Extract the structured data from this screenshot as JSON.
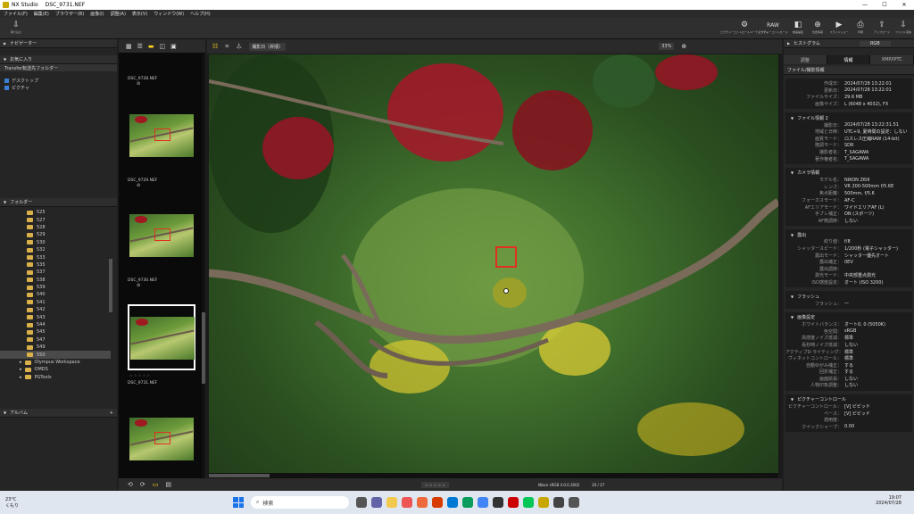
{
  "window": {
    "app": "NX Studio",
    "file": "DSC_9731.NEF",
    "min": "—",
    "max": "☐",
    "close": "✕"
  },
  "menu": [
    "ファイル(F)",
    "編集(E)",
    "ブラウザー(B)",
    "画像(I)",
    "調整(A)",
    "表示(V)",
    "ウィンドウ(W)",
    "ヘルプ(H)"
  ],
  "toolbar": {
    "import": "取り込む",
    "right": [
      {
        "icon": "picture-control-icon",
        "glyph": "⚙",
        "label": "ピクチャーコントロールユーティリティ"
      },
      {
        "icon": "raw-icon",
        "glyph": "RAW",
        "label": "ピクチャーコントロール"
      },
      {
        "icon": "compare-icon",
        "glyph": "◧",
        "label": "動画編集"
      },
      {
        "icon": "map-icon",
        "glyph": "⊕",
        "label": "位置情報"
      },
      {
        "icon": "slideshow-icon",
        "glyph": "▶",
        "label": "スライドショー"
      },
      {
        "icon": "print-icon",
        "glyph": "⎙",
        "label": "印刷"
      },
      {
        "icon": "upload-icon",
        "glyph": "⇪",
        "label": "アップロード"
      },
      {
        "icon": "export-icon",
        "glyph": "⇩",
        "label": "ファイル変換"
      }
    ]
  },
  "left": {
    "navigator": "ナビゲーター",
    "favorites": "お気に入り",
    "fav_items": [
      "Transfer転送先フォルダー",
      "デスクトップ",
      "ピクチャ"
    ],
    "folders_title": "フォルダー",
    "folders": [
      "525",
      "527",
      "528",
      "529",
      "530",
      "532",
      "533",
      "535",
      "537",
      "538",
      "539",
      "540",
      "541",
      "542",
      "543",
      "544",
      "545",
      "547",
      "549",
      "550"
    ],
    "subfolders": [
      "Olympus Workspace",
      "OMDS",
      "PGTools"
    ],
    "albums": "アルバム"
  },
  "filmstrip": {
    "items": [
      {
        "name": "DSC_9728.NEF"
      },
      {
        "name": "DSC_9729.NEF"
      },
      {
        "name": "DSC_9730.NEF"
      },
      {
        "name": "DSC_9731.NEF"
      }
    ],
    "rating": "☆ ☆ ☆ ☆ ☆"
  },
  "viewer": {
    "sort": "撮影日（昇順）",
    "zoom": "33%",
    "camera_info": "Nikon sRGB 4.0.0.3002",
    "page": "20 / 27"
  },
  "right": {
    "histogram": "ヒストグラム",
    "colorspace": "RGB",
    "tabs": [
      "調整",
      "情報",
      "XMP/IPTC"
    ],
    "info_title": "ファイル/撮影情報",
    "top_rows": [
      {
        "k": "作成日：",
        "v": "2024/07/28 13:22:01"
      },
      {
        "k": "更新日：",
        "v": "2024/07/28 13:22:01"
      },
      {
        "k": "ファイルサイズ：",
        "v": "29.6 MB"
      },
      {
        "k": "画像サイズ：",
        "v": "L (6048 x 4032), FX"
      }
    ],
    "sections": [
      {
        "title": "ファイル情報 2",
        "rows": [
          {
            "k": "撮影日：",
            "v": "2024/07/28 13:22:31.51"
          },
          {
            "k": "地域と日時：",
            "v": "UTC+9, 夏時間の設定：しない"
          },
          {
            "k": "画質モード：",
            "v": "ロスレス圧縮RAW (14-bit)"
          },
          {
            "k": "階調モード：",
            "v": "SDR"
          },
          {
            "k": "撮影者名：",
            "v": "T_SAGAWA"
          },
          {
            "k": "著作権者名：",
            "v": "T_SAGAWA"
          }
        ]
      },
      {
        "title": "カメラ情報",
        "rows": [
          {
            "k": "モデル名：",
            "v": "NIKON Z6III"
          },
          {
            "k": "レンズ：",
            "v": "VR 200-500mm f/5.6E"
          },
          {
            "k": "焦点距離：",
            "v": "500mm, f/5.6"
          },
          {
            "k": "フォーカスモード：",
            "v": "AF-C"
          },
          {
            "k": "AFエリアモード：",
            "v": "ワイドエリアAF (L)"
          },
          {
            "k": "手ブレ補正：",
            "v": "ON (スポーツ)"
          },
          {
            "k": "AF微調節：",
            "v": "しない"
          }
        ]
      },
      {
        "title": "露出",
        "rows": [
          {
            "k": "絞り値：",
            "v": "f/8"
          },
          {
            "k": "シャッタースピード：",
            "v": "1/200秒 (電子シャッター)"
          },
          {
            "k": "露出モード：",
            "v": "シャッター優先オート"
          },
          {
            "k": "露出補正：",
            "v": "0EV"
          },
          {
            "k": "露出調節：",
            "v": ""
          },
          {
            "k": "測光モード：",
            "v": "中央部重点測光"
          },
          {
            "k": "ISO感度設定：",
            "v": "オート (ISO 3200)"
          }
        ]
      },
      {
        "title": "フラッシュ",
        "rows": [
          {
            "k": "フラッシュ：",
            "v": "—"
          }
        ]
      },
      {
        "title": "画像設定",
        "rows": [
          {
            "k": "ホワイトバランス：",
            "v": "オート0, 0 (5050K)"
          },
          {
            "k": "色空間：",
            "v": "sRGB"
          },
          {
            "k": "高感度ノイズ低減：",
            "v": "標準"
          },
          {
            "k": "長秒時ノイズ低減：",
            "v": "しない"
          },
          {
            "k": "アクティブD-ライティング：",
            "v": "標準"
          },
          {
            "k": "ヴィネットコントロール：",
            "v": "標準"
          },
          {
            "k": "自動ゆがみ補正：",
            "v": "する"
          },
          {
            "k": "回折補正：",
            "v": "する"
          },
          {
            "k": "画面拡張：",
            "v": "しない"
          },
          {
            "k": "人物印象調整：",
            "v": "しない"
          }
        ]
      },
      {
        "title": "ピクチャーコントロール",
        "rows": [
          {
            "k": "ピクチャーコントロール：",
            "v": "[V] ビビッド"
          },
          {
            "k": "ベース：",
            "v": "[V] ビビッド"
          },
          {
            "k": "適用度：",
            "v": ""
          },
          {
            "k": "クイックシャープ：",
            "v": "0.00"
          }
        ]
      }
    ]
  },
  "taskbar": {
    "weather_temp": "23°C",
    "weather_desc": "くもり",
    "search": "検索",
    "time": "19:07",
    "date": "2024/07/28"
  }
}
